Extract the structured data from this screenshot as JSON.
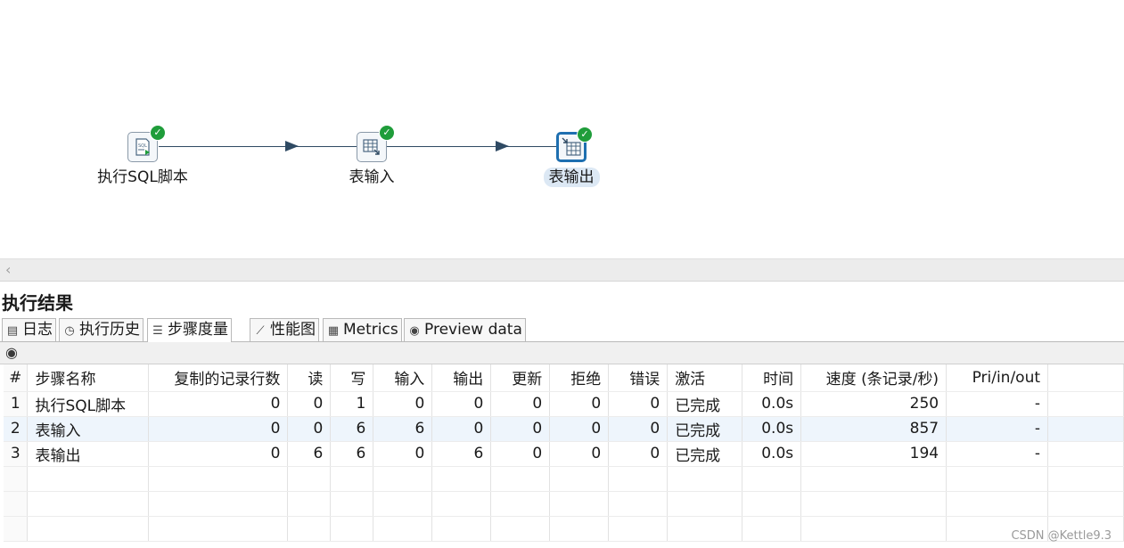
{
  "canvas": {
    "steps": [
      {
        "label": "执行SQL脚本",
        "icon": "sql-script-icon",
        "status": "ok"
      },
      {
        "label": "表输入",
        "icon": "table-input-icon",
        "status": "ok"
      },
      {
        "label": "表输出",
        "icon": "table-output-icon",
        "status": "ok",
        "selected": true
      }
    ]
  },
  "panel": {
    "title": "执行结果",
    "tabs": [
      {
        "label": "日志",
        "icon": "log-icon"
      },
      {
        "label": "执行历史",
        "icon": "history-icon"
      },
      {
        "label": "步骤度量",
        "icon": "step-metrics-icon",
        "active": true
      },
      {
        "label": "性能图",
        "icon": "performance-chart-icon"
      },
      {
        "label": "Metrics",
        "icon": "metrics-icon"
      },
      {
        "label": "Preview data",
        "icon": "eye-icon"
      }
    ]
  },
  "table": {
    "columns": [
      "#",
      "步骤名称",
      "复制的记录行数",
      "读",
      "写",
      "输入",
      "输出",
      "更新",
      "拒绝",
      "错误",
      "激活",
      "时间",
      "速度 (条记录/秒)",
      "Pri/in/out"
    ],
    "rows": [
      [
        "1",
        "执行SQL脚本",
        "0",
        "0",
        "1",
        "0",
        "0",
        "0",
        "0",
        "0",
        "已完成",
        "0.0s",
        "250",
        "-"
      ],
      [
        "2",
        "表输入",
        "0",
        "0",
        "6",
        "6",
        "0",
        "0",
        "0",
        "0",
        "已完成",
        "0.0s",
        "857",
        "-"
      ],
      [
        "3",
        "表输出",
        "0",
        "6",
        "6",
        "0",
        "6",
        "0",
        "0",
        "0",
        "已完成",
        "0.0s",
        "194",
        "-"
      ]
    ]
  },
  "watermark": "CSDN @Kettle9.3",
  "colors": {
    "hop": "#2f4a63",
    "ok": "#1f9d3a",
    "selected": "#1e6fb0",
    "alt_row": "#eef5fc"
  }
}
